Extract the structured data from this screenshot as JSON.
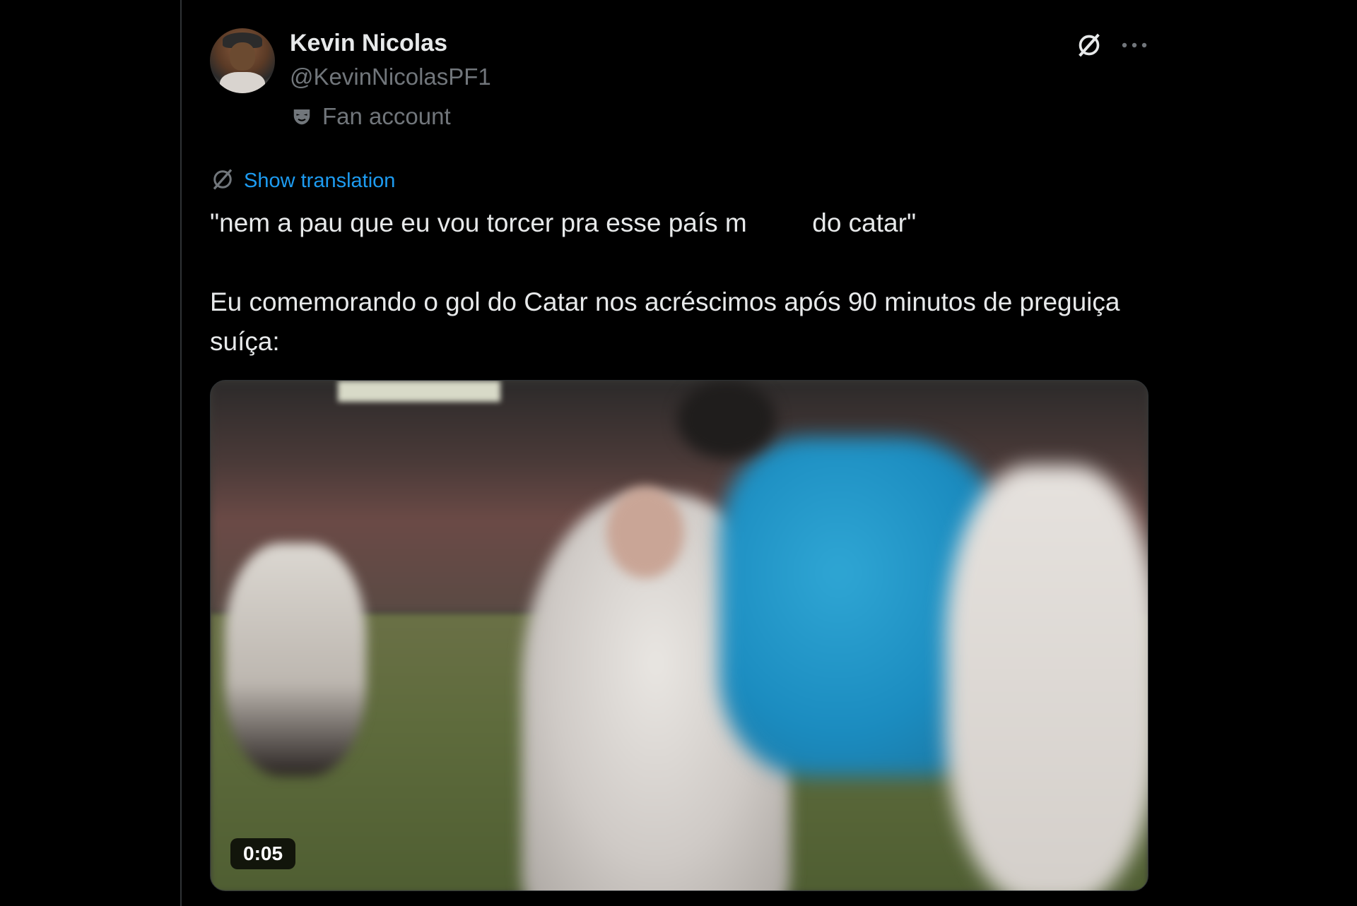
{
  "author": {
    "name": "Kevin Nicolas",
    "handle": "@KevinNicolasPF1",
    "label": "Fan account"
  },
  "icons": {
    "avatar": "user-avatar",
    "grok": "grok-icon",
    "more": "more-horizontal-icon",
    "fan": "mask-icon",
    "translate": "translate-icon"
  },
  "tweet": {
    "translate_label": "Show translation",
    "text_line1": "\"nem a pau que eu vou torcer pra esse país m         do catar\"",
    "text_line2": "Eu comemorando o gol do Catar nos acréscimos após 90 minutos de preguiça suíça:"
  },
  "media": {
    "duration": "0:05"
  },
  "colors": {
    "background": "#000000",
    "primary_text": "#e7e9ea",
    "secondary_text": "#71767b",
    "link": "#1d9bf0",
    "border": "#2f3336"
  }
}
